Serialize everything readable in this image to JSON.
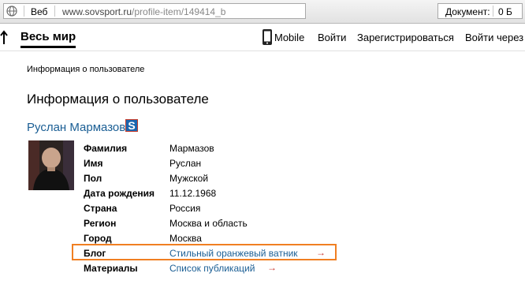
{
  "addressbar": {
    "mode_label": "Веб",
    "url_domain": "www.sovsport.ru",
    "url_path": "/profile-item/149414_b",
    "doc_label": "Документ:",
    "doc_size": "0 Б"
  },
  "nav": {
    "section_title": "Весь мир",
    "mobile_label": "Mobile",
    "login_label": "Войти",
    "register_label": "Зарегистрироваться",
    "login_via_label": "Войти через"
  },
  "breadcrumb": "Информация о пользователе",
  "page_title": "Информация о пользователе",
  "user": {
    "name": "Руслан Мармазов",
    "badge_letter": "S",
    "fields": [
      {
        "label": "Фамилия",
        "value": "Мармазов"
      },
      {
        "label": "Имя",
        "value": "Руслан"
      },
      {
        "label": "Пол",
        "value": "Мужской"
      },
      {
        "label": "Дата рождения",
        "value": "11.12.1968"
      },
      {
        "label": "Страна",
        "value": "Россия"
      },
      {
        "label": "Регион",
        "value": "Москва и область"
      },
      {
        "label": "Город",
        "value": "Москва"
      },
      {
        "label": "Блог",
        "value": "Стильный оранжевый ватник",
        "arrow": "→"
      },
      {
        "label": "Материалы",
        "value": "Список публикаций",
        "arrow": "→"
      }
    ]
  },
  "colors": {
    "link": "#1a5e94",
    "arrow": "#c8312a",
    "highlight": "#f07f22",
    "badge": "#1a66b0"
  }
}
